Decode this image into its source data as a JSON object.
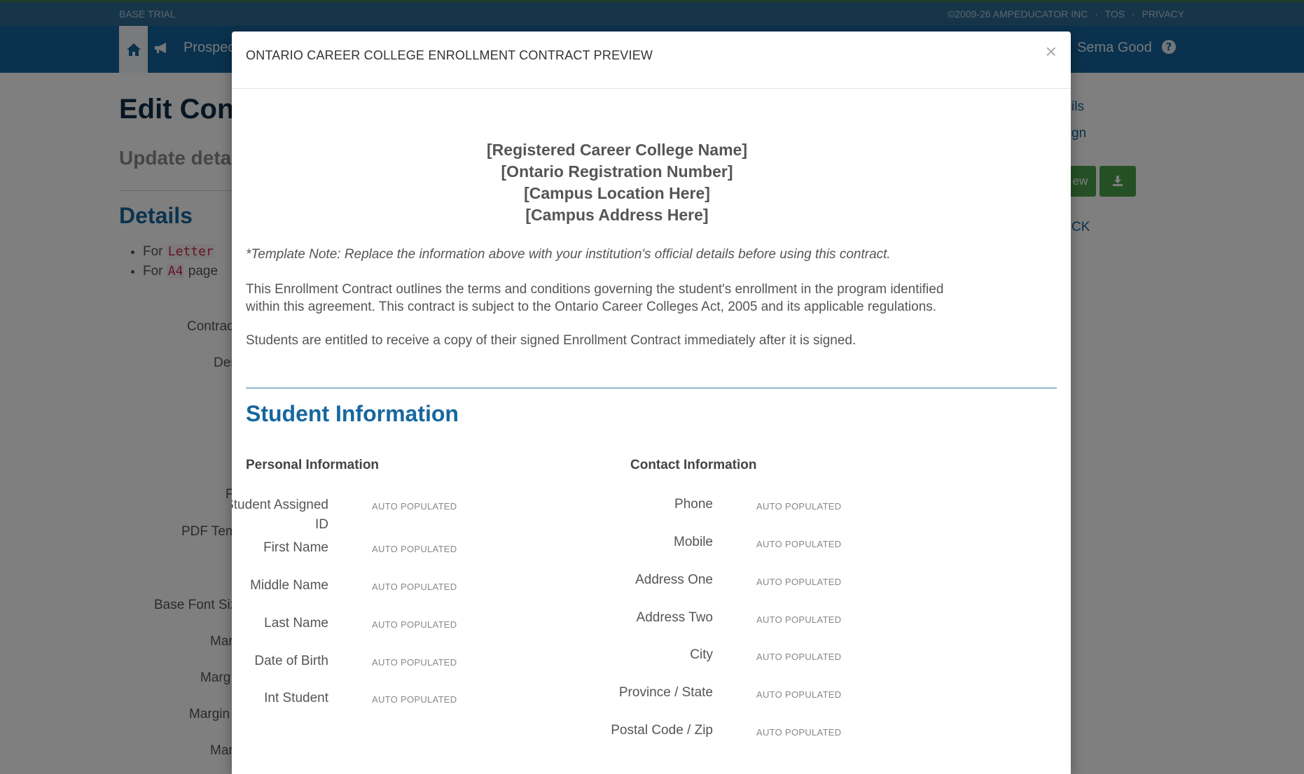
{
  "topbar": {
    "trial": "BASE TRIAL",
    "copyright": "©2009-26 AMPEDUCATOR INC",
    "sep": "·",
    "tos": "TOS",
    "privacy": "PRIVACY"
  },
  "navbar": {
    "prospect_label": "Prospec",
    "user_name": "Sema Good"
  },
  "page": {
    "title": "Edit Cont",
    "subtitle": "Update details",
    "details_heading": "Details",
    "list": [
      {
        "prefix": "For",
        "code": "Letter"
      },
      {
        "prefix": "For",
        "code": "A4",
        "suffix": "page"
      }
    ],
    "labels": [
      "Contrac",
      "Des",
      "F",
      "PDF Tem",
      "Base Font Siz",
      "Mar",
      "Marg",
      "Margin",
      "Mar"
    ],
    "side_links": [
      "ils",
      "gn",
      "ew",
      "CK"
    ]
  },
  "modal": {
    "title": "ONTARIO CAREER COLLEGE ENROLLMENT CONTRACT PREVIEW",
    "close": "×",
    "college_lines": [
      "[Registered Career College Name]",
      "[Ontario Registration Number]",
      "[Campus Location Here]",
      "[Campus Address Here]"
    ],
    "template_note": "*Template Note: Replace the information above with your institution's official details before using this contract.",
    "paragraph1": "This Enrollment Contract outlines the terms and conditions governing the student's enrollment in the program identified within this agreement. This contract is subject to the Ontario Career Colleges Act, 2005 and its applicable regulations.",
    "paragraph2": "Students are entitled to receive a copy of their signed Enrollment Contract immediately after it is signed.",
    "section_title": "Student Information",
    "personal_heading": "Personal Information",
    "contact_heading": "Contact Information",
    "placeholder": "AUTO POPULATED",
    "personal_fields": [
      "Student Assigned ID",
      "First Name",
      "Middle Name",
      "Last Name",
      "Date of Birth",
      "Int Student"
    ],
    "contact_fields": [
      "Phone",
      "Mobile",
      "Address One",
      "Address Two",
      "City",
      "Province / State",
      "Postal Code / Zip"
    ]
  },
  "colors": {
    "navbar": "#15659c",
    "accent": "#17679e",
    "button": "#4aa14a"
  }
}
